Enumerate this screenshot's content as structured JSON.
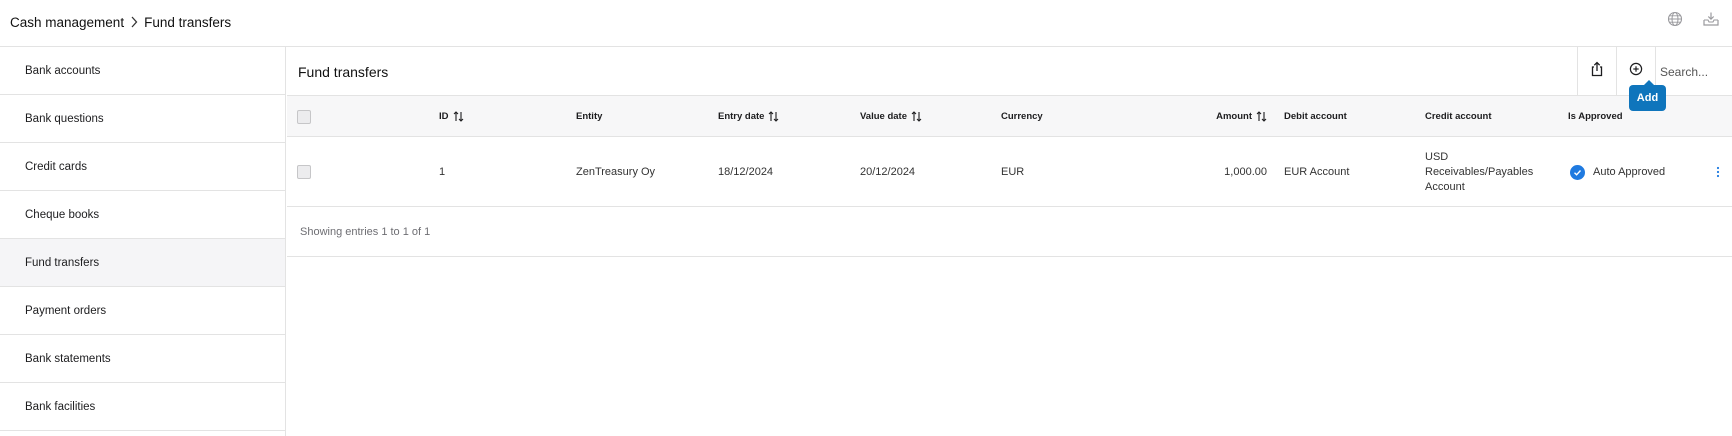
{
  "breadcrumb": {
    "parent": "Cash management",
    "current": "Fund transfers"
  },
  "top_icons": [
    "globe-icon",
    "download-tray-icon"
  ],
  "sidebar": {
    "items": [
      {
        "label": "Bank accounts"
      },
      {
        "label": "Bank questions"
      },
      {
        "label": "Credit cards"
      },
      {
        "label": "Cheque books"
      },
      {
        "label": "Fund transfers",
        "active": true
      },
      {
        "label": "Payment orders"
      },
      {
        "label": "Bank statements"
      },
      {
        "label": "Bank facilities"
      }
    ]
  },
  "main": {
    "title": "Fund transfers",
    "add_tooltip": "Add",
    "search_placeholder": "Search..."
  },
  "table": {
    "columns": {
      "id": "ID",
      "entity": "Entity",
      "entry_date": "Entry date",
      "value_date": "Value date",
      "currency": "Currency",
      "amount": "Amount",
      "debit_account": "Debit account",
      "credit_account": "Credit account",
      "is_approved": "Is Approved"
    },
    "rows": [
      {
        "id": "1",
        "entity": "ZenTreasury Oy",
        "entry_date": "18/12/2024",
        "value_date": "20/12/2024",
        "currency": "EUR",
        "amount": "1,000.00",
        "debit_account": "EUR Account",
        "credit_account_lines": [
          "USD",
          "Receivables/Payables",
          "Account"
        ],
        "approval": "Auto Approved"
      }
    ],
    "footer": "Showing entries 1 to 1 of 1"
  },
  "colors": {
    "accent": "#0f75bc",
    "approved": "#1f7ae0",
    "border": "#e3e3e3",
    "header_bg": "#f7f7f8"
  }
}
